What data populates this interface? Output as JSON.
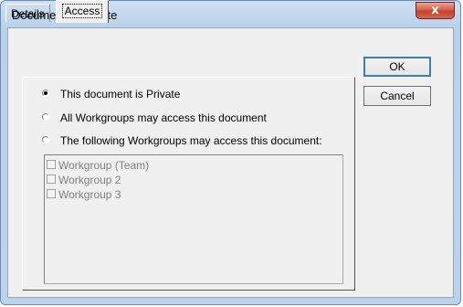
{
  "window": {
    "title": "Document Template",
    "close_glyph": "x"
  },
  "tabs": [
    {
      "label": "Details",
      "active": false
    },
    {
      "label": "Access",
      "active": true
    }
  ],
  "access": {
    "options": [
      {
        "label": "This document is Private",
        "selected": true
      },
      {
        "label": "All Workgroups may access this document",
        "selected": false
      },
      {
        "label": "The following Workgroups may access this document:",
        "selected": false
      }
    ],
    "workgroups": [
      {
        "label": "Workgroup (Team)",
        "checked": false,
        "enabled": false
      },
      {
        "label": "Workgroup 2",
        "checked": false,
        "enabled": false
      },
      {
        "label": "Workgroup 3",
        "checked": false,
        "enabled": false
      }
    ]
  },
  "buttons": {
    "ok": "OK",
    "cancel": "Cancel"
  },
  "colors": {
    "title_bar": "#b9d1ea",
    "close_button": "#c3412a",
    "dialog_bg": "#f0f0f0",
    "disabled_text": "#808080",
    "default_button_border": "#3c7fb1"
  }
}
